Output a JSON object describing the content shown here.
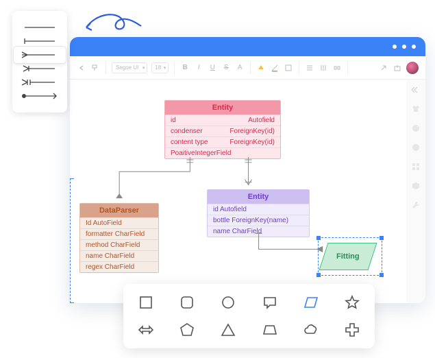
{
  "connector_palette": {
    "items": [
      "line-plain",
      "line-bar-end",
      "line-crowfoot",
      "line-crowfoot-one",
      "line-crowfoot-many",
      "line-dot-arrow"
    ],
    "selected_index": 2
  },
  "window": {
    "titlebar_dots": 3
  },
  "toolbar": {
    "font_select": "Segoe UI",
    "size_select": "18",
    "buttons": [
      "undo",
      "format-painter",
      "bold",
      "italic",
      "underline",
      "strike",
      "font-color",
      "fill",
      "line-color",
      "border-style",
      "align",
      "valign",
      "distribute",
      "share",
      "export"
    ]
  },
  "side_rail": {
    "icons": [
      "expand",
      "shirt",
      "palette",
      "smiley",
      "apps",
      "cube",
      "wrench"
    ]
  },
  "entities": {
    "pink": {
      "title": "Entity",
      "rows": [
        {
          "l": "id",
          "r": "Autofield"
        },
        {
          "l": "condenser",
          "r": "ForeignKey(id)"
        },
        {
          "l": "content type",
          "r": "ForeignKey(id)"
        },
        {
          "l": "PoaitiveIntegerField",
          "r": ""
        }
      ]
    },
    "brown": {
      "title": "DataParser",
      "rows": [
        {
          "l": "Id AutoField"
        },
        {
          "l": "formatter CharField"
        },
        {
          "l": "method CharField"
        },
        {
          "l": "name CharField"
        },
        {
          "l": "regex CharField"
        }
      ]
    },
    "purple": {
      "title": "Entity",
      "rows": [
        {
          "l": "id Autofield",
          "r": ""
        },
        {
          "l": "bottle ForeignKey(name)",
          "r": ""
        },
        {
          "l": "name CharField",
          "r": ""
        }
      ]
    }
  },
  "fitting": {
    "label": "Fitting"
  },
  "shape_tray": {
    "row1": [
      "square",
      "square-round",
      "circle",
      "speech",
      "parallelogram",
      "star"
    ],
    "row2": [
      "double-arrow",
      "pentagon",
      "triangle",
      "trapezoid",
      "cloud",
      "plus"
    ],
    "selected": "parallelogram"
  },
  "colors": {
    "accent": "#3b82f6"
  }
}
